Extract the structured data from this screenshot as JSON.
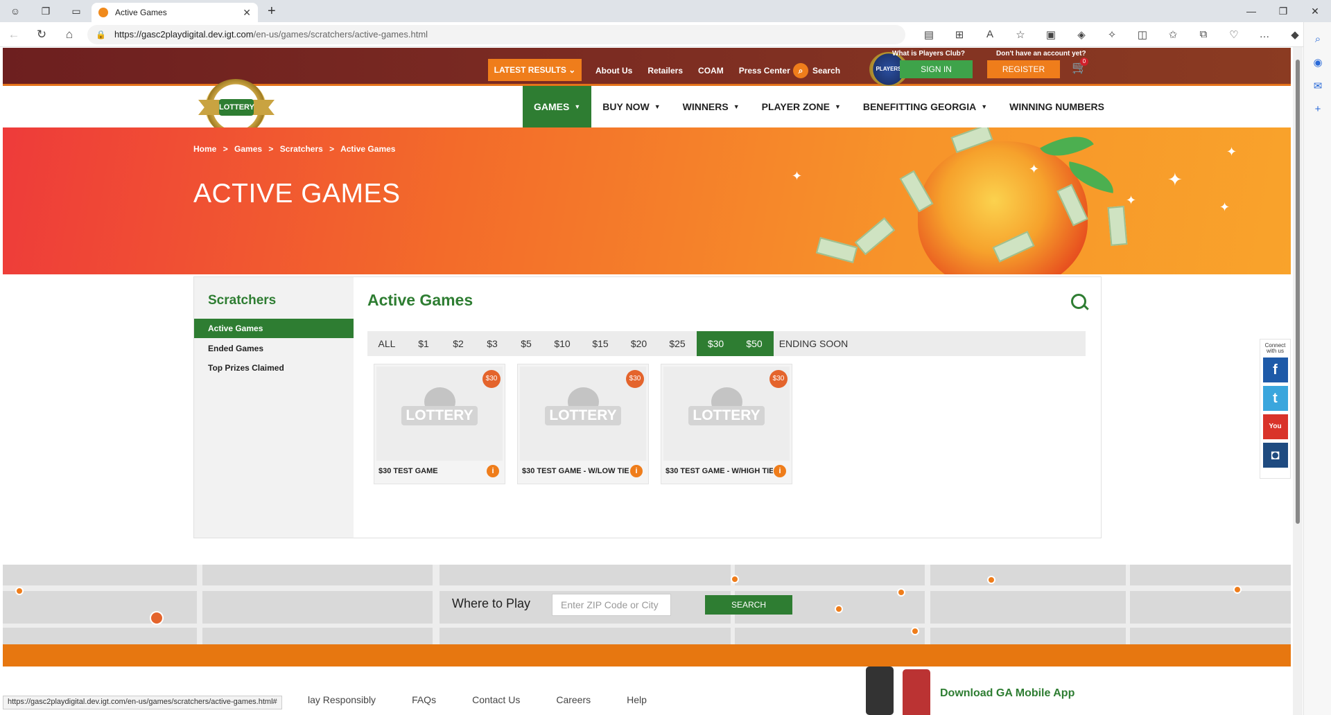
{
  "browser": {
    "tab_title": "Active Games",
    "url_host": "https://gasc2playdigital.dev.igt.com",
    "url_path": "/en-us/games/scratchers/active-games.html",
    "status_url": "https://gasc2playdigital.dev.igt.com/en-us/games/scratchers/active-games.html#"
  },
  "topbar": {
    "latest_results": "LATEST RESULTS",
    "links": [
      "About Us",
      "Retailers",
      "COAM",
      "Press Center"
    ],
    "search": "Search",
    "players_club_q": "What is Players Club?",
    "players_badge": "PLAYERS CLUB",
    "sign_in": "SIGN IN",
    "no_account": "Don't have an account yet?",
    "register": "REGISTER",
    "cart_count": "0"
  },
  "logo": {
    "text": "LOTTERY"
  },
  "mainnav": [
    {
      "label": "GAMES",
      "active": true,
      "caret": true
    },
    {
      "label": "BUY NOW",
      "caret": true
    },
    {
      "label": "WINNERS",
      "caret": true
    },
    {
      "label": "PLAYER ZONE",
      "caret": true
    },
    {
      "label": "BENEFITTING GEORGIA",
      "caret": true
    },
    {
      "label": "WINNING NUMBERS",
      "caret": false
    }
  ],
  "hero": {
    "breadcrumb": [
      "Home",
      ">",
      "Games",
      ">",
      "Scratchers",
      ">",
      "Active Games"
    ],
    "title": "ACTIVE GAMES"
  },
  "sidebar": {
    "title": "Scratchers",
    "items": [
      "Active Games",
      "Ended Games",
      "Top Prizes Claimed"
    ]
  },
  "main": {
    "title": "Active Games",
    "filters": [
      {
        "label": "ALL"
      },
      {
        "label": "$1"
      },
      {
        "label": "$2"
      },
      {
        "label": "$3"
      },
      {
        "label": "$5"
      },
      {
        "label": "$10"
      },
      {
        "label": "$15"
      },
      {
        "label": "$20"
      },
      {
        "label": "$25"
      },
      {
        "label": "$30",
        "active": true
      },
      {
        "label": "$50",
        "active": true
      },
      {
        "label": "ENDING SOON"
      }
    ],
    "cards": [
      {
        "name": "$30 TEST GAME",
        "price": "$30",
        "logo": "LOTTERY"
      },
      {
        "name": "$30 TEST GAME - W/LOW TIER",
        "price": "$30",
        "logo": "LOTTERY"
      },
      {
        "name": "$30 TEST GAME - W/HIGH TIER",
        "price": "$30",
        "logo": "LOTTERY"
      }
    ]
  },
  "social": {
    "label": "Connect with us",
    "items": [
      {
        "name": "facebook-icon",
        "glyph": "f",
        "color": "#1e5aa8"
      },
      {
        "name": "twitter-icon",
        "glyph": "t",
        "color": "#3aa6dd"
      },
      {
        "name": "youtube-icon",
        "glyph": "You",
        "color": "#d9332a"
      },
      {
        "name": "instagram-icon",
        "glyph": "◘",
        "color": "#1f4b80"
      }
    ]
  },
  "where_to_play": {
    "label": "Where to Play",
    "placeholder": "Enter ZIP Code or City",
    "button": "SEARCH"
  },
  "footer": {
    "links": [
      "lay Responsibly",
      "FAQs",
      "Contact Us",
      "Careers",
      "Help"
    ],
    "download": "Download GA Mobile App"
  },
  "colors": {
    "green": "#2e7d32",
    "orange": "#ef7d1b",
    "maroon": "#6d1f1f"
  }
}
